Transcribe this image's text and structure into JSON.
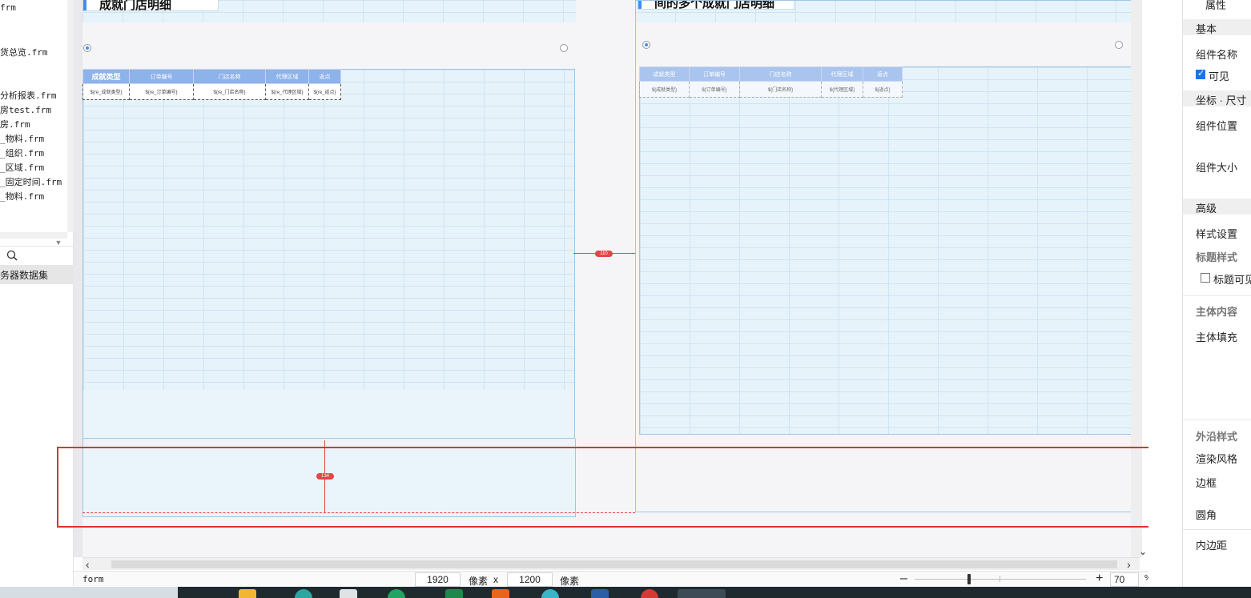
{
  "file_list": [
    "frm",
    "货总览.frm",
    "分析报表.frm",
    "房test.frm",
    "房.frm",
    "_物料.frm",
    "_组织.frm",
    "_区域.frm",
    "_固定时间.frm",
    "_物料.frm"
  ],
  "left_panel": {
    "dataset_label": "务器数据集"
  },
  "canvas": {
    "left_panel_title": "成就门店明细",
    "right_panel_title": "间的多个成就门店明细",
    "left_table": {
      "headers": [
        "成就类型",
        "订单编号",
        "门店名称",
        "代理区域",
        "返点"
      ],
      "row": [
        "${re_成就类型}",
        "${re_订单编号}",
        "${re_门店名称}",
        "${re_代理区域}",
        "${re_返点}"
      ]
    },
    "right_table": {
      "headers": [
        "成就类型",
        "订单编号",
        "门店名称",
        "代理区域",
        "返点"
      ],
      "row": [
        "${成就类型}",
        "${订单编号}",
        "${门店名称}",
        "${代理区域}",
        "${返点}"
      ]
    },
    "measure_horizontal": "110",
    "measure_vertical": "134"
  },
  "status_bar": {
    "form_label": "form",
    "width_value": "1920",
    "unit1": "像素",
    "times": "x",
    "height_value": "1200",
    "unit2": "像素",
    "zoom_minus": "–",
    "zoom_plus": "+",
    "zoom_value": "70",
    "zoom_unit": "%"
  },
  "properties": {
    "tab_title": "属性",
    "basic_header": "基本",
    "component_name_label": "组件名称",
    "visible_label": "可见",
    "visible_checked": true,
    "coord_header": "坐标 · 尺寸",
    "position_label": "组件位置",
    "size_label": "组件大小",
    "advanced_header": "高级",
    "style_settings_label": "样式设置",
    "title_style_label": "标题样式",
    "title_visible_label": "标题可见",
    "title_visible_checked": false,
    "body_content_label": "主体内容",
    "body_fill_label": "主体填充",
    "edge_style_label": "外沿样式",
    "render_style_label": "渲染风格",
    "border_label": "边框",
    "radius_label": "圆角",
    "padding_label": "内边距"
  },
  "colors": {
    "accent": "#3e8ef0",
    "highlight": "#e0312f",
    "header_fill": "#8eb2ea",
    "panel_bg": "#eaf4fb"
  }
}
